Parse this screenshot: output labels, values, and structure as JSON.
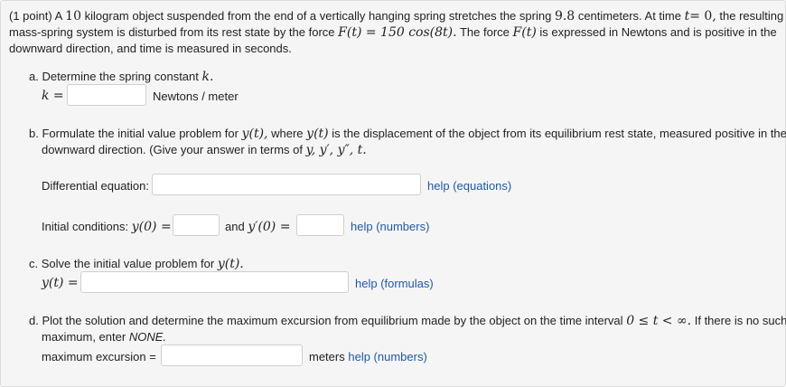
{
  "intro": {
    "prefix": "(1 point) A",
    "mass_value": "10",
    "mass_tail": "kilogram object suspended from the end of a vertically hanging spring stretches the spring",
    "stretch_value": "9.8",
    "stretch_tail": "centimeters. At time",
    "time_var": "t",
    "time_eq": "= 0,",
    "time_tail": "the resulting",
    "line2_prefix": "mass-spring system is disturbed from its rest state by the force",
    "force_expr": "F(t) = 150 cos(8t).",
    "line2_mid": "The force",
    "force_var": "F(t)",
    "line2_tail": "is expressed in Newtons and is positive in the",
    "line3": "downward direction, and time is measured in seconds."
  },
  "part_a": {
    "prompt": "a. Determine the spring constant",
    "k_var": "k.",
    "k_label": "k =",
    "k_value": "",
    "units": "Newtons / meter"
  },
  "part_b": {
    "prompt1_prefix": "b. Formulate the initial value problem for",
    "y_of_t": "y(t),",
    "prompt1_mid": "where",
    "y_of_t2": "y(t)",
    "prompt1_tail": "is the displacement of the object from its equilibrium rest state, measured positive in the",
    "prompt2_prefix": "downward direction. (Give your answer in terms of",
    "vars": "y, y′, y″, t.",
    "de_label": "Differential equation:",
    "de_value": "",
    "de_help": "help (equations)",
    "ic_label": "Initial conditions:",
    "ic_y0": "y(0) =",
    "ic_y0_value": "",
    "ic_and": "and",
    "ic_yp0": "y′(0) =",
    "ic_yp0_value": "",
    "ic_help": "help (numbers)"
  },
  "part_c": {
    "prompt": "c. Solve the initial value problem for",
    "y_of_t": "y(t).",
    "yt_label": "y(t) =",
    "yt_value": "",
    "help": "help (formulas)"
  },
  "part_d": {
    "prompt1": "d. Plot the solution and determine the maximum excursion from equilibrium made by the object on the time interval",
    "interval": "0 ≤ t < ∞.",
    "prompt1_tail": "If there is no such",
    "prompt2_prefix": "maximum, enter",
    "none_word": "NONE.",
    "max_label": "maximum excursion =",
    "max_value": "",
    "units": "meters",
    "help": "help (numbers)"
  }
}
